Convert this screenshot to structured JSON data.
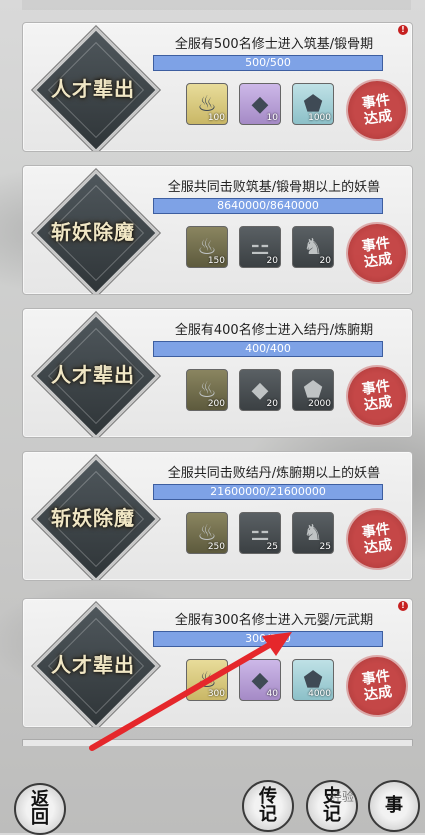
{
  "cards": [
    {
      "title": "人才辈出",
      "desc": "全服有500名修士进入筑基/锻骨期",
      "progress": "500/500",
      "progress_fraction": 1.0,
      "rewards": [
        {
          "icon": "flame-seed-icon",
          "count": "100",
          "style": "gold"
        },
        {
          "icon": "crystal-shard-icon",
          "count": "10",
          "style": "purple"
        },
        {
          "icon": "jade-chunk-icon",
          "count": "1000",
          "style": "teal"
        }
      ],
      "stamp": "事件达成",
      "alert": "!"
    },
    {
      "title": "斩妖除魔",
      "desc": "全服共同击败筑基/锻骨期以上的妖兽",
      "progress": "8640000/8640000",
      "progress_fraction": 1.0,
      "rewards": [
        {
          "icon": "flame-seed-icon",
          "count": "150",
          "style": "olive"
        },
        {
          "icon": "scroll-bundle-icon",
          "count": "20",
          "style": "dark"
        },
        {
          "icon": "beast-figure-icon",
          "count": "20",
          "style": "dark"
        }
      ],
      "stamp": "事件达成",
      "alert": ""
    },
    {
      "title": "人才辈出",
      "desc": "全服有400名修士进入结丹/炼腑期",
      "progress": "400/400",
      "progress_fraction": 1.0,
      "rewards": [
        {
          "icon": "flame-seed-icon",
          "count": "200",
          "style": "olive"
        },
        {
          "icon": "crystal-shard-icon",
          "count": "20",
          "style": "dark"
        },
        {
          "icon": "jade-chunk-icon",
          "count": "2000",
          "style": "dark"
        }
      ],
      "stamp": "事件达成",
      "alert": ""
    },
    {
      "title": "斩妖除魔",
      "desc": "全服共同击败结丹/炼腑期以上的妖兽",
      "progress": "21600000/21600000",
      "progress_fraction": 1.0,
      "rewards": [
        {
          "icon": "flame-seed-icon",
          "count": "250",
          "style": "olive"
        },
        {
          "icon": "scroll-bundle-icon",
          "count": "25",
          "style": "dark"
        },
        {
          "icon": "beast-figure-icon",
          "count": "25",
          "style": "dark"
        }
      ],
      "stamp": "事件达成",
      "alert": ""
    },
    {
      "title": "人才辈出",
      "desc": "全服有300名修士进入元婴/元武期",
      "progress": "300/300",
      "progress_fraction": 1.0,
      "rewards": [
        {
          "icon": "flame-seed-icon",
          "count": "300",
          "style": "gold"
        },
        {
          "icon": "crystal-shard-icon",
          "count": "40",
          "style": "purple"
        },
        {
          "icon": "jade-chunk-icon",
          "count": "4000",
          "style": "teal"
        }
      ],
      "stamp": "事件达成",
      "alert": "!"
    }
  ],
  "bottom_bar": {
    "back_label": "返回",
    "legend_label": "传记",
    "events_label": "史记",
    "fourth_label": "事"
  },
  "watermark": "经验",
  "colors": {
    "accent_bar": "#7ea2e6",
    "stamp_red": "#c23a3a",
    "alert_red": "#c62020"
  }
}
